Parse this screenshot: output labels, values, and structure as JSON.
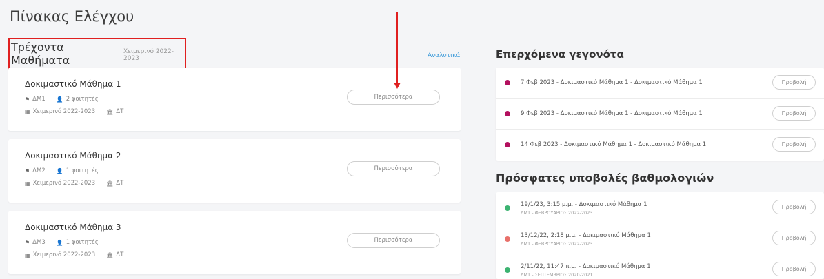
{
  "page": {
    "title": "Πίνακας Ελέγχου"
  },
  "current_courses": {
    "title": "Τρέχοντα Μαθήματα",
    "semester": "Χειμερινό 2022-2023",
    "details_link": "Αναλυτικά",
    "more_label": "Περισσότερα",
    "items": [
      {
        "title": "Δοκιμαστικό Μάθημα 1",
        "code": "ΔΜ1",
        "students": "2 φοιτητές",
        "semester": "Χειμερινό 2022-2023",
        "dept": "ΔΤ"
      },
      {
        "title": "Δοκιμαστικό Μάθημα 2",
        "code": "ΔΜ2",
        "students": "1 φοιτητές",
        "semester": "Χειμερινό 2022-2023",
        "dept": "ΔΤ"
      },
      {
        "title": "Δοκιμαστικό Μάθημα 3",
        "code": "ΔΜ3",
        "students": "1 φοιτητές",
        "semester": "Χειμερινό 2022-2023",
        "dept": "ΔΤ"
      }
    ]
  },
  "upcoming_events": {
    "title": "Επερχόμενα γεγονότα",
    "view_label": "Προβολή",
    "items": [
      {
        "text": "7 Φεβ 2023 - Δοκιμαστικό Μάθημα 1 - Δοκιμαστικό Μάθημα 1",
        "color": "#b3105e"
      },
      {
        "text": "9 Φεβ 2023 - Δοκιμαστικό Μάθημα 1 - Δοκιμαστικό Μάθημα 1",
        "color": "#b3105e"
      },
      {
        "text": "14 Φεβ 2023 - Δοκιμαστικό Μάθημα 1 - Δοκιμαστικό Μάθημα 1",
        "color": "#b3105e"
      }
    ]
  },
  "recent_grades": {
    "title": "Πρόσφατες υποβολές βαθμολογιών",
    "view_label": "Προβολή",
    "items": [
      {
        "text": "19/1/23, 3:15 μ.μ. - Δοκιμαστικό Μάθημα 1",
        "sub": "ΔΜ1 - ΦΕΒΡΟΥΑΡΙΟΣ 2022-2023",
        "color": "#3cb371"
      },
      {
        "text": "13/12/22, 2:18 μ.μ. - Δοκιμαστικό Μάθημα 1",
        "sub": "ΔΜ1 - ΦΕΒΡΟΥΑΡΙΟΣ 2022-2023",
        "color": "#e8706a"
      },
      {
        "text": "2/11/22, 11:47 π.μ. - Δοκιμαστικό Μάθημα 1",
        "sub": "ΔΜ1 - ΣΕΠΤΕΜΒΡΙΟΣ 2020-2021",
        "color": "#3cb371"
      }
    ]
  },
  "icons": {
    "flag": "flag-icon",
    "users": "user-icon",
    "calendar": "calendar-icon",
    "institution": "institution-icon"
  },
  "colors": {
    "accent": "#3b9ad9",
    "highlight": "#e02020"
  }
}
